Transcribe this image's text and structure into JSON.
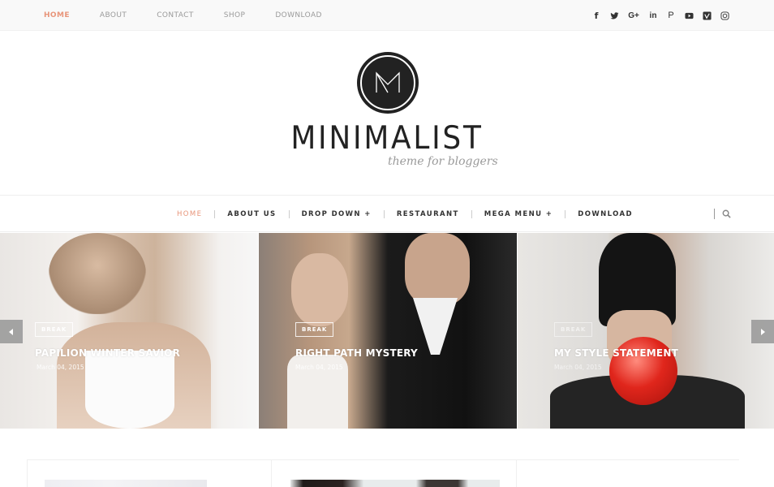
{
  "topbar": {
    "nav": [
      {
        "label": "HOME",
        "active": true
      },
      {
        "label": "ABOUT",
        "active": false
      },
      {
        "label": "CONTACT",
        "active": false
      },
      {
        "label": "SHOP",
        "active": false
      },
      {
        "label": "DOWNLOAD",
        "active": false
      }
    ],
    "social": [
      {
        "name": "facebook",
        "glyph": "f"
      },
      {
        "name": "twitter",
        "glyph": ""
      },
      {
        "name": "google-plus",
        "glyph": "G+"
      },
      {
        "name": "linkedin",
        "glyph": "in"
      },
      {
        "name": "pinterest",
        "glyph": "P"
      },
      {
        "name": "youtube",
        "glyph": ""
      },
      {
        "name": "vimeo",
        "glyph": "V"
      },
      {
        "name": "instagram",
        "glyph": ""
      }
    ]
  },
  "branding": {
    "logo_letter": "M",
    "title": "MINIMALIST",
    "tagline": "theme for bloggers"
  },
  "mainnav": {
    "items": [
      {
        "label": "HOME",
        "active": true
      },
      {
        "label": "ABOUT US",
        "active": false
      },
      {
        "label": "DROP DOWN +",
        "active": false
      },
      {
        "label": "RESTAURANT",
        "active": false
      },
      {
        "label": "MEGA MENU +",
        "active": false
      },
      {
        "label": "DOWNLOAD",
        "active": false
      }
    ],
    "search_icon": "search-icon"
  },
  "slider": {
    "slides": [
      {
        "label": "BREAK",
        "title": "PAPILION WINTER SAVIOR",
        "date": "March 04, 2015"
      },
      {
        "label": "BREAK",
        "title": "RIGHT PATH MYSTERY",
        "date": "March 04, 2015"
      },
      {
        "label": "BREAK",
        "title": "MY STYLE STATEMENT",
        "date": "March 04, 2015"
      }
    ],
    "prev_icon": "chevron-left-icon",
    "next_icon": "chevron-right-icon"
  },
  "colors": {
    "accent": "#e8957a",
    "text_dark": "#222222",
    "text_muted": "#9a9a9a",
    "topbar_bg": "#f9f9f9"
  }
}
